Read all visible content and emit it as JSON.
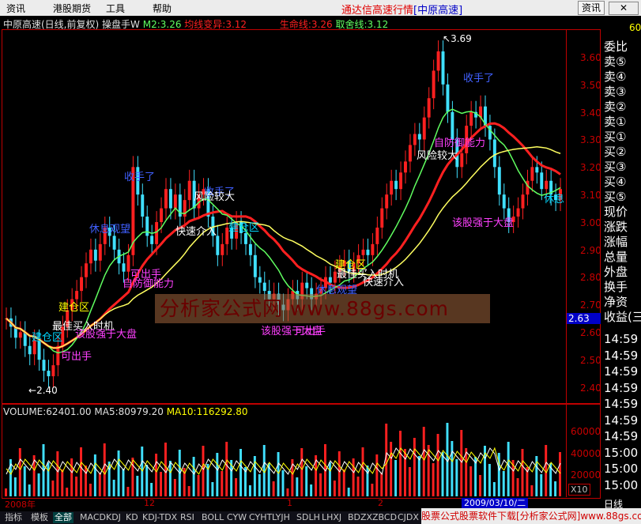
{
  "menubar": {
    "items": [
      "资讯",
      "港股期货",
      "工具",
      "帮助"
    ],
    "title": "通达信高速行情",
    "title_bracket": "[中原高速]",
    "info_button": "资讯",
    "close_button": "✕"
  },
  "chart_header": {
    "stock": "中原高速(日线,前复权)",
    "indicator": "操盘手W",
    "m2": "M2:3.26",
    "avg_change": "均线变异:3.12",
    "life_line": "生命线:3.26",
    "take_line": "取舍线:3.12"
  },
  "right_panel": {
    "top_num": "60",
    "items": [
      "委比",
      "卖⑤",
      "卖④",
      "卖③",
      "卖②",
      "卖①",
      "买①",
      "买②",
      "买③",
      "买④",
      "买⑤",
      "现价",
      "涨跌",
      "涨幅",
      "总量",
      "外盘",
      "换手",
      "净资",
      "收益(三"
    ],
    "times": [
      "14:59",
      "14:59",
      "14:59",
      "14:59",
      "14:59",
      "14:59",
      "14:59",
      "15:00",
      "15:00",
      "15:00"
    ],
    "bottom": "日线"
  },
  "price_axis": [
    "3.60",
    "3.50",
    "3.40",
    "3.30",
    "3.20",
    "3.10",
    "3.00",
    "2.90",
    "2.80",
    "2.70",
    "2.60",
    "2.50",
    "2.40"
  ],
  "price_badge": "2.63",
  "high_label": "3.69",
  "low_label": "2.40",
  "volume_header": {
    "volume": "VOLUME:62401.00",
    "ma5": "MA5:80979.20",
    "ma10": "MA10:116292.80"
  },
  "volume_axis": [
    "60000",
    "40000",
    "20000"
  ],
  "x10": "X10",
  "date_axis": [
    "2008年",
    "12",
    "1",
    "2"
  ],
  "date_badge": "2009/03/10/二",
  "watermark": "分析家公式网 www.88gs.com",
  "annotations": [
    {
      "text": "收手了",
      "cls": "blue"
    },
    {
      "text": "休息观望",
      "cls": "blue"
    },
    {
      "text": "收手了",
      "cls": "blue"
    },
    {
      "text": "风险较大",
      "cls": "white"
    },
    {
      "text": "快速介入",
      "cls": "white"
    },
    {
      "text": "建仓区",
      "cls": "cyan"
    },
    {
      "text": "可出手",
      "cls": "magenta"
    },
    {
      "text": "自防御能力",
      "cls": "magenta"
    },
    {
      "text": "建仓区",
      "cls": "yellow"
    },
    {
      "text": "最佳买入时机",
      "cls": "white"
    },
    {
      "text": "建仓区",
      "cls": "cyan"
    },
    {
      "text": "该股强于大盘",
      "cls": "magenta"
    },
    {
      "text": "可出手",
      "cls": "magenta"
    },
    {
      "text": "该股强于大盘",
      "cls": "magenta"
    },
    {
      "text": "可出手",
      "cls": "magenta"
    },
    {
      "text": "建仓区",
      "cls": "yellow"
    },
    {
      "text": "最佳买入时机",
      "cls": "white"
    },
    {
      "text": "休息观望",
      "cls": "blue"
    },
    {
      "text": "快速介入",
      "cls": "white"
    },
    {
      "text": "收手了",
      "cls": "blue"
    },
    {
      "text": "风险较大",
      "cls": "white"
    },
    {
      "text": "自防御能力",
      "cls": "magenta"
    },
    {
      "text": "该股强于大盘",
      "cls": "magenta"
    },
    {
      "text": "休息",
      "cls": "cyan"
    }
  ],
  "tabs": [
    "指标",
    "模板",
    "全部",
    "MACD",
    "KDJ",
    "KD",
    "KDJ-TDX",
    "RSI",
    "BOLL",
    "CYW",
    "CYHT",
    "LYJH",
    "SDLH",
    "LHXJ",
    "BDZX",
    "ZBCD",
    "CJDX"
  ],
  "ad_text": "股票公式股票软件下载[分析家公式网]www.88gs.com"
}
